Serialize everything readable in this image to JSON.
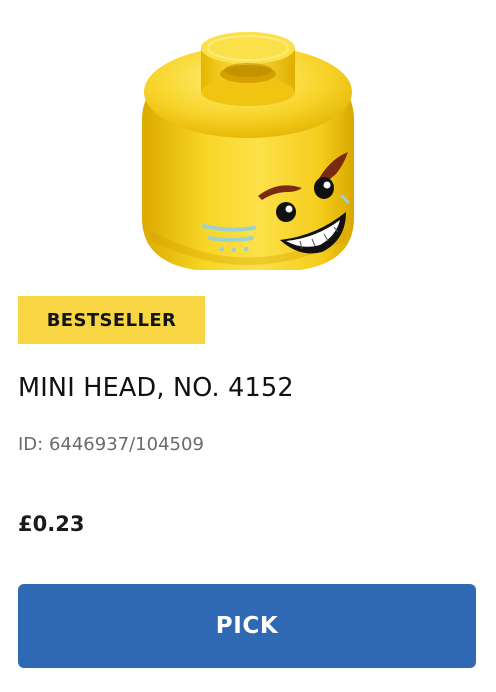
{
  "product": {
    "image_alt": "Minifigure head",
    "badge": "BESTSELLER",
    "title": "MINI HEAD, NO. 4152",
    "id_text": "ID: 6446937/104509",
    "price": "£0.23",
    "button_label": "PICK"
  },
  "colors": {
    "badge": "#f7d543",
    "button": "#2f69b3",
    "head_yellow": "#f7d11c",
    "id_text": "#6b6b6b"
  }
}
